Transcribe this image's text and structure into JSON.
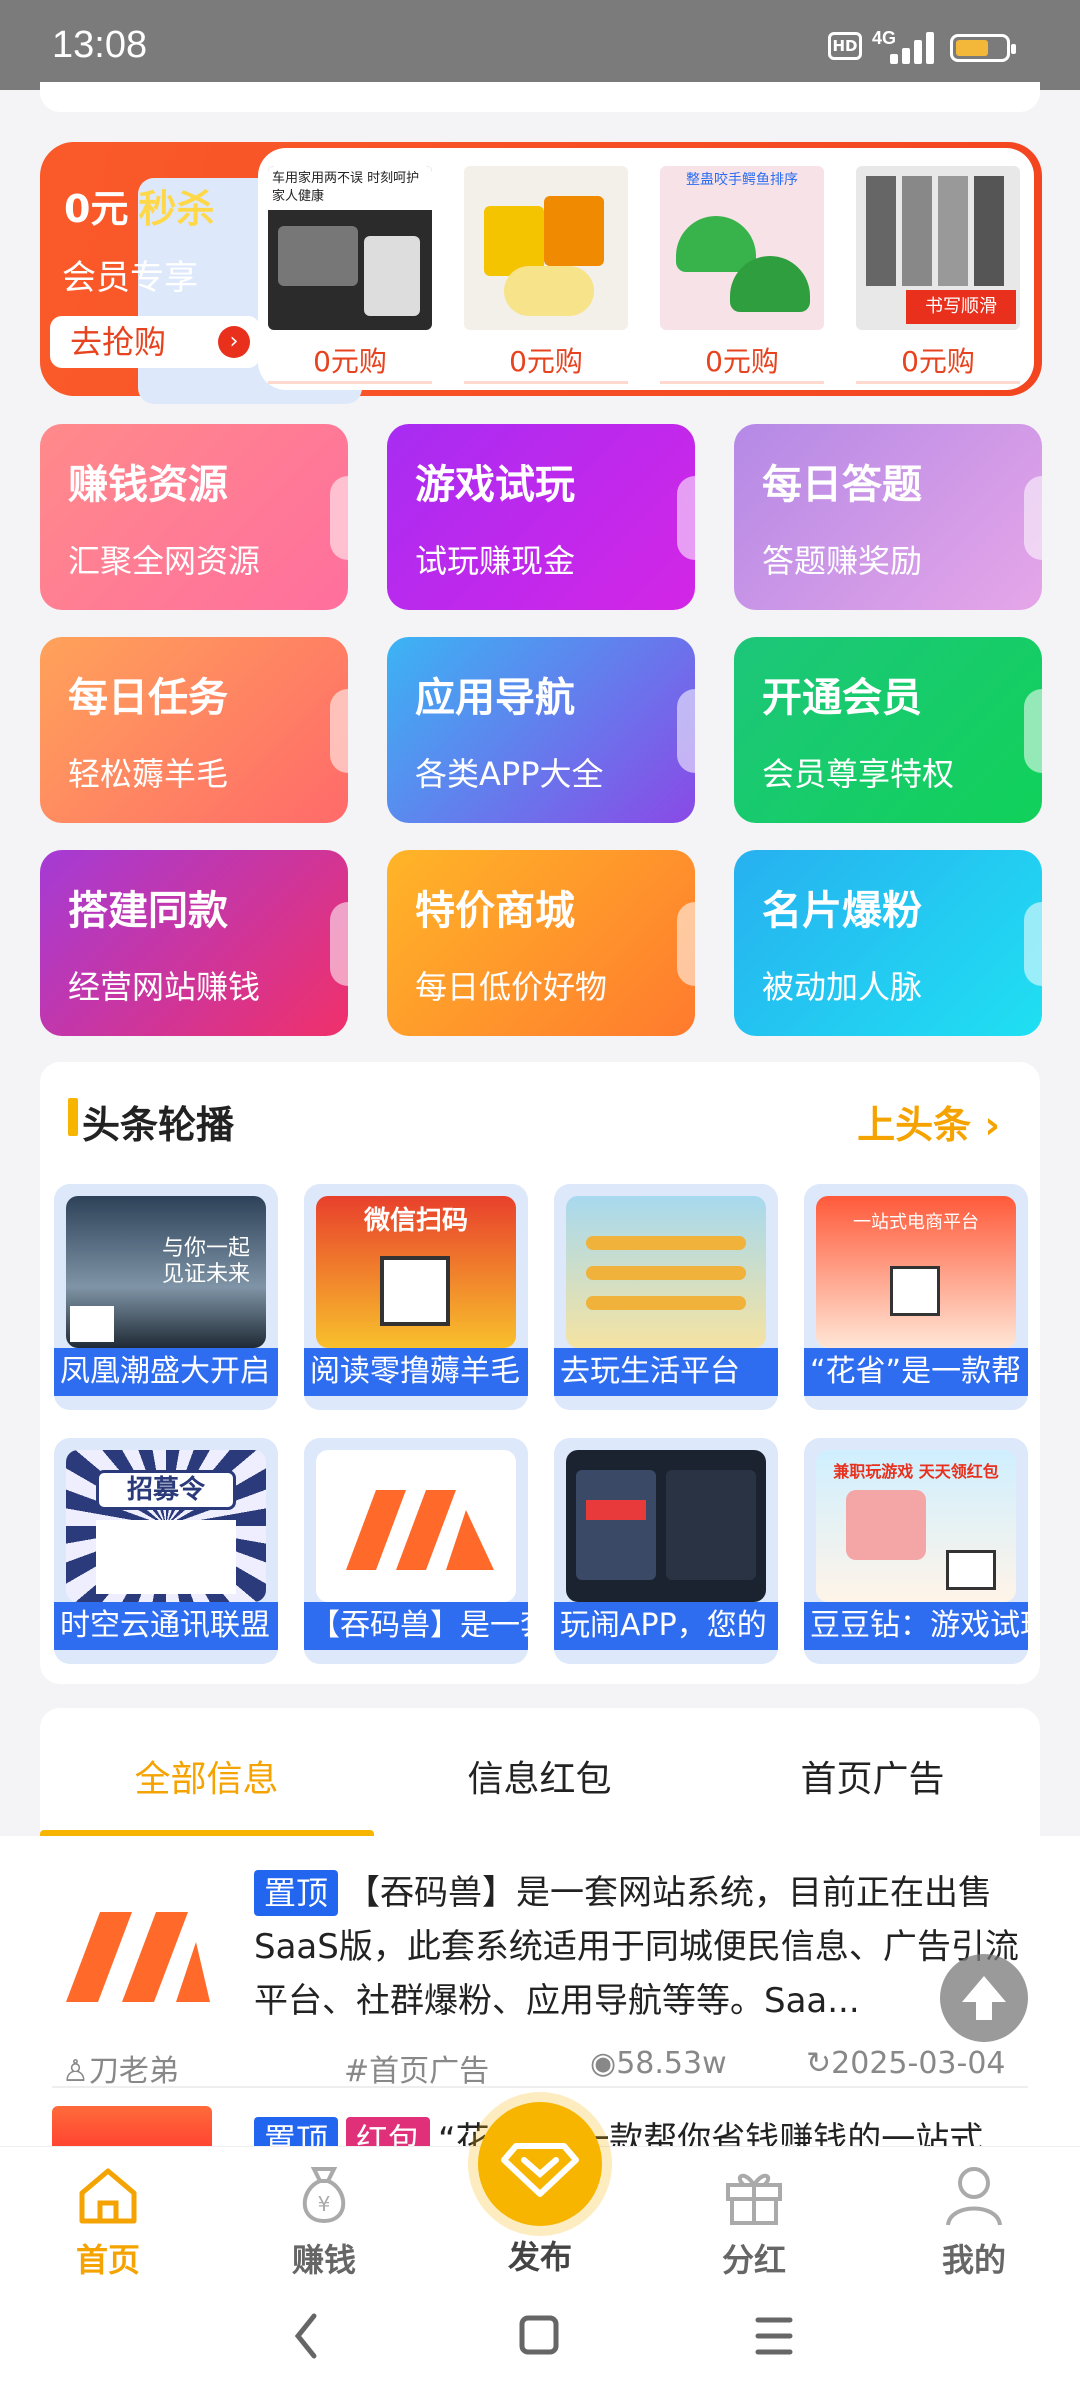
{
  "status_bar": {
    "time": "13:08",
    "hd": "HD",
    "network": "4G"
  },
  "flash_sale": {
    "title_price": "0元",
    "title_sale": "秒杀",
    "subtitle": "会员专享",
    "button": "去抢购",
    "products": [
      {
        "price": "0元购",
        "label": "车用家用两不误 时刻呵护 家人健康"
      },
      {
        "price": "0元购",
        "label": ""
      },
      {
        "price": "0元购",
        "label": "整蛊咬手鳄鱼排序"
      },
      {
        "price": "0元购",
        "label": "书写顺滑"
      }
    ]
  },
  "grid": [
    {
      "title": "赚钱资源",
      "subtitle": "汇聚全网资源"
    },
    {
      "title": "游戏试玩",
      "subtitle": "试玩赚现金"
    },
    {
      "title": "每日答题",
      "subtitle": "答题赚奖励"
    },
    {
      "title": "每日任务",
      "subtitle": "轻松薅羊毛"
    },
    {
      "title": "应用导航",
      "subtitle": "各类APP大全"
    },
    {
      "title": "开通会员",
      "subtitle": "会员尊享特权"
    },
    {
      "title": "搭建同款",
      "subtitle": "经营网站赚钱"
    },
    {
      "title": "特价商城",
      "subtitle": "每日低价好物"
    },
    {
      "title": "名片爆粉",
      "subtitle": "被动加人脉"
    }
  ],
  "headlines": {
    "title": "头条轮播",
    "more": "上头条",
    "items": [
      {
        "caption": "凤凰潮盛大开启",
        "pic_text": "与你一起 见证未来"
      },
      {
        "caption": "阅读零撸薅羊毛",
        "pic_text": "微信扫码"
      },
      {
        "caption": "去玩生活平台",
        "pic_text": ""
      },
      {
        "caption": "“花省”是一款帮",
        "pic_text": "一站式电商平台"
      },
      {
        "caption": "时空云通讯联盟",
        "pic_text": "招募令"
      },
      {
        "caption": "【吞码兽】是一套",
        "pic_text": ""
      },
      {
        "caption": "玩闹APP，您的",
        "pic_text": ""
      },
      {
        "caption": "豆豆钻：游戏试玩",
        "pic_text": "兼职玩游戏 天天领红包"
      }
    ]
  },
  "tabs": [
    "全部信息",
    "信息红包",
    "首页广告"
  ],
  "feed": {
    "item1": {
      "badge": "置顶",
      "text": "【吞码兽】是一套网站系统，目前正在出售SaaS版，此套系统适用于同城便民信息、广告引流平台、社群爆粉、应用导航等等。Saa...",
      "author": "刀老弟",
      "category": "#首页广告",
      "views": "58.53w",
      "date": "2025-03-04"
    },
    "item2": {
      "badge_top": "置顶",
      "badge_red": "红包",
      "text": "“花省”是一款帮你省钱赚钱的一站式"
    }
  },
  "bottom_nav": [
    "首页",
    "赚钱",
    "发布",
    "分红",
    "我的"
  ],
  "colors": {
    "accent": "#f7b500",
    "accent_text": "#f5a300",
    "pin_badge": "#2266f0"
  }
}
